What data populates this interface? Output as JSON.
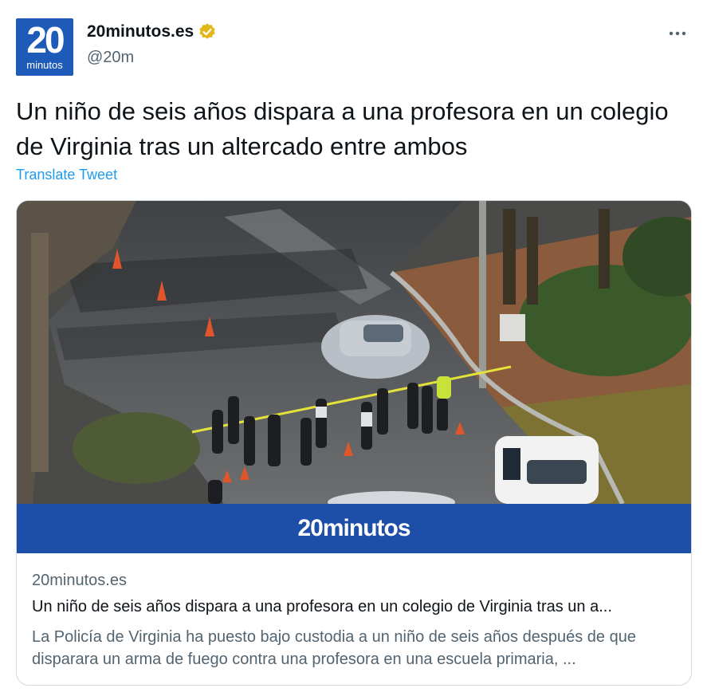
{
  "account": {
    "avatar_number": "20",
    "avatar_word": "minutos",
    "display_name": "20minutos.es",
    "handle": "@20m",
    "verified_badge_icon": "gold-verified-badge-icon",
    "more_icon": "more-options-icon"
  },
  "tweet": {
    "text": "Un niño de seis años dispara a una profesora en un colegio de Virginia tras un altercado entre ambos",
    "translate_label": "Translate Tweet"
  },
  "card": {
    "image_icon": "news-photo-police-scene",
    "banner_text": "20minutos",
    "domain": "20minutos.es",
    "title": "Un niño de seis años dispara a una profesora en un colegio de Virginia tras un a...",
    "description": "La Policía de Virginia ha puesto bajo custodia a un niño de seis años después de que disparara un arma de fuego contra una profesora en una escuela primaria, ..."
  },
  "colors": {
    "link": "#1d9bf0",
    "secondary_text": "#536471",
    "brand_blue": "#1d4fa8",
    "verified_gold": "#e2b719"
  }
}
